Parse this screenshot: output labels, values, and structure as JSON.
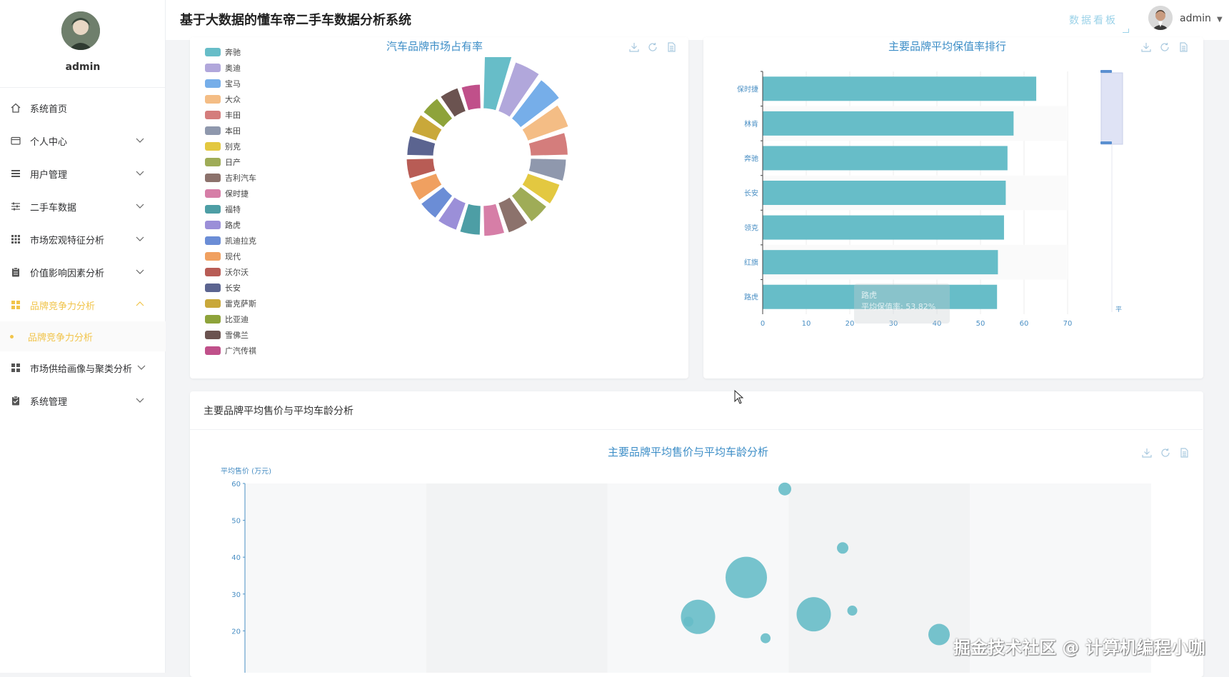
{
  "app": {
    "title": "基于大数据的懂车帝二手车数据分析系统",
    "dashboard_link": "数据看板",
    "username": "admin"
  },
  "profile": {
    "name": "admin"
  },
  "sidebar": {
    "items": [
      {
        "label": "系统首页",
        "icon": "home-icon"
      },
      {
        "label": "个人中心",
        "icon": "wallet-icon"
      },
      {
        "label": "用户管理",
        "icon": "list-icon"
      },
      {
        "label": "二手车数据",
        "icon": "sliders-icon"
      },
      {
        "label": "市场宏观特征分析",
        "icon": "grid-icon"
      },
      {
        "label": "价值影响因素分析",
        "icon": "clipboard-icon"
      },
      {
        "label": "品牌竞争力分析",
        "icon": "grid-icon"
      },
      {
        "label": "市场供给画像与聚类分析",
        "icon": "grid-icon"
      },
      {
        "label": "系统管理",
        "icon": "clipboard-check-icon"
      }
    ],
    "active_sub": "品牌竞争力分析"
  },
  "colors": {
    "accent": "#f1c44a",
    "primary": "#3d8ec7",
    "bar": "#67bdc8"
  },
  "pie_chart": {
    "title": "汽车品牌市场占有率",
    "chart_data": {
      "type": "pie",
      "title": "汽车品牌市场占有率",
      "rose": true,
      "legend_position": "left",
      "categories": [
        "奔驰",
        "奥迪",
        "宝马",
        "大众",
        "丰田",
        "本田",
        "别克",
        "日产",
        "吉利汽车",
        "保时捷",
        "福特",
        "路虎",
        "凯迪拉克",
        "现代",
        "沃尔沃",
        "长安",
        "雷克萨斯",
        "比亚迪",
        "雪佛兰",
        "广汽传祺"
      ],
      "values": [
        100,
        74,
        68,
        58,
        48,
        45,
        42,
        40,
        38,
        36,
        34,
        33,
        32,
        31,
        30,
        29,
        28,
        27,
        26,
        25
      ],
      "colors": [
        "#67bdc8",
        "#b1a7db",
        "#76aee9",
        "#f4bd85",
        "#d47d7c",
        "#8f98ad",
        "#e3c840",
        "#9fac57",
        "#8c726c",
        "#d67ea7",
        "#4d9ea5",
        "#9b8fd8",
        "#6b8dd6",
        "#f0a060",
        "#b85c55",
        "#5b6490",
        "#c9a83a",
        "#8ea33a",
        "#6b5350",
        "#c0508a"
      ]
    }
  },
  "bar_chart": {
    "title": "主要品牌平均保值率排行",
    "chart_data": {
      "type": "bar",
      "orientation": "horizontal",
      "title": "主要品牌平均保值率排行",
      "categories": [
        "保时捷",
        "林肯",
        "奔驰",
        "长安",
        "领克",
        "红旗",
        "路虎"
      ],
      "values": [
        62.8,
        57.6,
        56.2,
        55.8,
        55.4,
        54.0,
        53.8
      ],
      "xlim": [
        0,
        70
      ],
      "xticks": [
        "0",
        "10",
        "20",
        "30",
        "40",
        "50",
        "60",
        "70"
      ],
      "grid": true
    },
    "tooltip": {
      "name": "路虎",
      "text": "平均保值率: 53.82%"
    },
    "axis_unit_fragment": "平"
  },
  "section": {
    "title": "主要品牌平均售价与平均车龄分析"
  },
  "scatter_chart": {
    "title": "主要品牌平均售价与平均车龄分析",
    "chart_data": {
      "type": "scatter",
      "title": "主要品牌平均售价与平均车龄分析",
      "ylabel": "平均售价 (万元)",
      "ylim": [
        0,
        60
      ],
      "yticks": [
        "60",
        "50",
        "40",
        "30",
        "20"
      ],
      "points": [
        {
          "x": 4.3,
          "y": 58.5,
          "size": 9
        },
        {
          "x": 4.6,
          "y": 42.5,
          "size": 8
        },
        {
          "x": 4.1,
          "y": 34.5,
          "size": 29
        },
        {
          "x": 4.65,
          "y": 25.5,
          "size": 7
        },
        {
          "x": 4.45,
          "y": 24.5,
          "size": 24
        },
        {
          "x": 3.85,
          "y": 23.8,
          "size": 24
        },
        {
          "x": 3.8,
          "y": 22.5,
          "size": 7
        },
        {
          "x": 5.1,
          "y": 19.0,
          "size": 15
        },
        {
          "x": 4.2,
          "y": 18.0,
          "size": 7
        }
      ]
    }
  },
  "watermark": "掘金技术社区 @ 计算机编程小咖"
}
